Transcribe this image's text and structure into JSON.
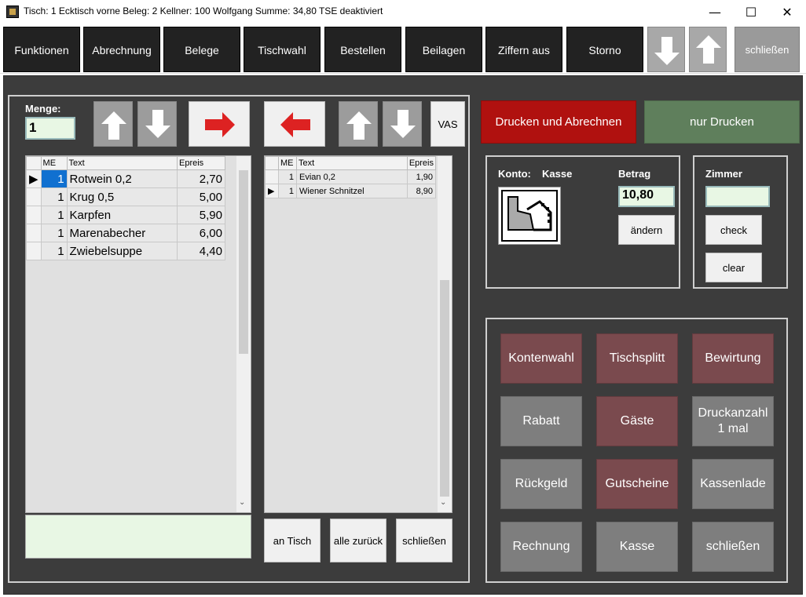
{
  "window": {
    "title": "Tisch: 1 Ecktisch vorne  Beleg: 2  Kellner: 100 Wolfgang  Summe: 34,80  TSE deaktiviert",
    "minimize": "—",
    "maximize": "☐",
    "close": "✕"
  },
  "toolbar": {
    "items": [
      "Funktionen",
      "Abrechnung",
      "Belege",
      "Tischwahl",
      "Bestellen",
      "Beilagen",
      "Ziffern aus",
      "Storno"
    ],
    "close_label": "schließen"
  },
  "left_panel": {
    "menge_label": "Menge:",
    "menge_value": "1",
    "vas_label": "VAS",
    "grid_left": {
      "headers": [
        "ME",
        "Text",
        "Epreis"
      ],
      "rows": [
        {
          "me": "1",
          "text": "Rotwein 0,2",
          "price": "2,70"
        },
        {
          "me": "1",
          "text": "Krug 0,5",
          "price": "5,00"
        },
        {
          "me": "1",
          "text": "Karpfen",
          "price": "5,90"
        },
        {
          "me": "1",
          "text": "Marenabecher",
          "price": "6,00"
        },
        {
          "me": "1",
          "text": "Zwiebelsuppe",
          "price": "4,40"
        }
      ]
    },
    "grid_right": {
      "headers": [
        "ME",
        "Text",
        "Epreis"
      ],
      "rows": [
        {
          "me": "1",
          "text": "Evian 0,2",
          "price": "1,90"
        },
        {
          "me": "1",
          "text": "Wiener Schnitzel",
          "price": "8,90"
        }
      ]
    },
    "buttons": {
      "an_tisch": "an Tisch",
      "alle_zurueck": "alle zurück",
      "schliessen": "schließen"
    }
  },
  "right_panel": {
    "print_and_bill": "Drucken und Abrechnen",
    "print_only": "nur Drucken",
    "konto_label": "Konto:",
    "konto_value": "Kasse",
    "betrag_label": "Betrag",
    "betrag_value": "10,80",
    "aendern": "ändern",
    "zimmer_label": "Zimmer",
    "zimmer_value": "",
    "check": "check",
    "clear": "clear",
    "actions": [
      {
        "label": "Kontenwahl",
        "style": "maroon"
      },
      {
        "label": "Tischsplitt",
        "style": "maroon"
      },
      {
        "label": "Bewirtung",
        "style": "maroon"
      },
      {
        "label": "Rabatt",
        "style": "gray"
      },
      {
        "label": "Gäste",
        "style": "maroon"
      },
      {
        "label": "Druckanzahl\n1 mal",
        "style": "gray"
      },
      {
        "label": "Rückgeld",
        "style": "gray"
      },
      {
        "label": "Gutscheine",
        "style": "maroon"
      },
      {
        "label": "Kassenlade",
        "style": "gray"
      },
      {
        "label": "Rechnung",
        "style": "gray"
      },
      {
        "label": "Kasse",
        "style": "gray"
      },
      {
        "label": "schließen",
        "style": "gray"
      }
    ]
  },
  "colors": {
    "background": "#3c3c3c",
    "primary_red": "#b0110f",
    "primary_green": "#5f7f5c",
    "maroon": "#7a4a4e",
    "gray": "#7e7e7e"
  }
}
